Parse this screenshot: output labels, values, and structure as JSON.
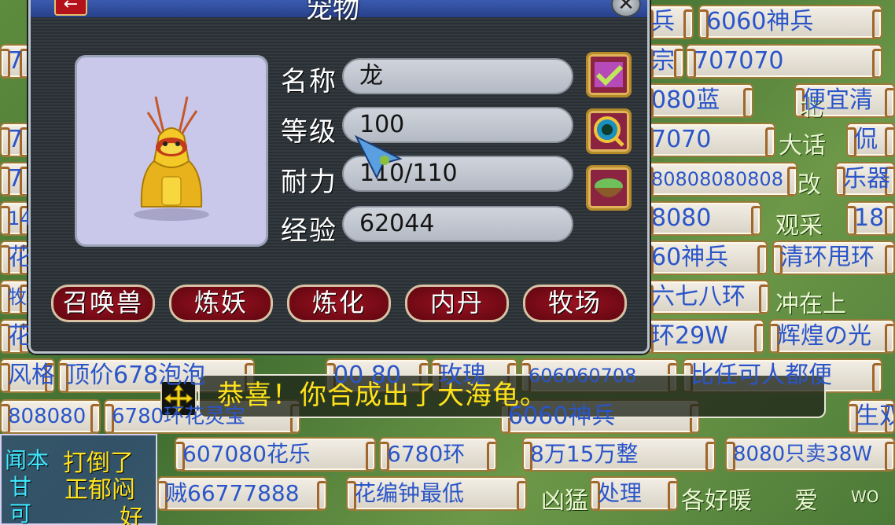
{
  "window": {
    "title": "宠物",
    "back_icon": "←",
    "close_icon": "✕",
    "fields": [
      {
        "label": "名称",
        "value": "龙"
      },
      {
        "label": "等级",
        "value": "100"
      },
      {
        "label": "耐力",
        "value": "110/110"
      },
      {
        "label": "经验",
        "value": "62044"
      }
    ],
    "side_icons": [
      "checkbox-icon",
      "magnifier-icon",
      "food-bowl-icon"
    ],
    "buttons": [
      "召唤兽",
      "炼妖",
      "炼化",
      "内丹",
      "牧场"
    ]
  },
  "message": "恭喜！你合成出了大海龟。",
  "stalls": [
    "兵",
    "6060神兵",
    "7",
    "宗",
    "707070",
    "北",
    "080蓝",
    "便宜清",
    "7",
    "7070",
    "大话",
    "侃",
    "7",
    "80808080808",
    "改",
    "乐器",
    "14",
    "8080",
    "观采",
    "18",
    "花",
    "60神兵",
    "清环甩环",
    "牧现",
    "六七八环",
    "冲在上",
    "花",
    "环29W",
    "辉煌の光",
    "风格",
    "顶价678泡泡",
    "00  80",
    "玫瑰",
    "606060708",
    "比任可人都便",
    "808080",
    "6780环花灵宝",
    "6060神兵",
    "生双",
    "607080花乐",
    "6780环",
    "8万15万整",
    "8080只卖38W",
    "贼66777888",
    "花编钟最低",
    "处理"
  ],
  "corner_text": [
    "打倒了",
    "正郁闷",
    "好"
  ],
  "corner_side": [
    "闻本",
    "甘",
    "可"
  ],
  "right_bottom": [
    "凶猛",
    "各好暖",
    "爱",
    "WO"
  ],
  "colors": {
    "accent_red": "#9a1220",
    "msg_yellow": "#ffe21a",
    "stall_blue": "#2a55c9"
  }
}
